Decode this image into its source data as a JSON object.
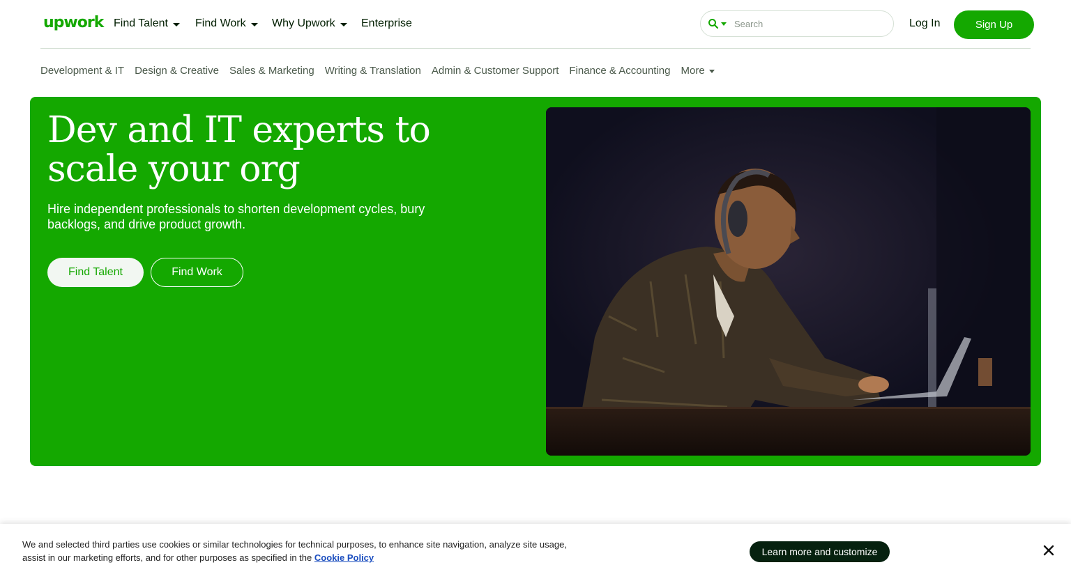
{
  "header": {
    "logo": "upwork",
    "nav": [
      {
        "label": "Find Talent",
        "dropdown": true
      },
      {
        "label": "Find Work",
        "dropdown": true
      },
      {
        "label": "Why Upwork",
        "dropdown": true
      },
      {
        "label": "Enterprise",
        "dropdown": false
      }
    ],
    "search_placeholder": "Search",
    "login_label": "Log In",
    "signup_label": "Sign Up"
  },
  "categories": [
    "Development & IT",
    "Design & Creative",
    "Sales & Marketing",
    "Writing & Translation",
    "Admin & Customer Support",
    "Finance & Accounting"
  ],
  "more_label": "More",
  "hero": {
    "title": "Dev and IT experts to scale your org",
    "subtitle": "Hire independent professionals to shorten development cycles, bury backlogs, and drive product growth.",
    "find_talent_label": "Find Talent",
    "find_work_label": "Find Work"
  },
  "cookie": {
    "text": "We and selected third parties use cookies or similar technologies for technical purposes, to enhance site navigation, analyze site usage, assist in our marketing efforts, and for other purposes as specified in the",
    "link_label": "Cookie Policy",
    "learn_label": "Learn more and customize"
  },
  "colors": {
    "brand_green": "#14a800",
    "dark_button": "#06210f"
  },
  "icons": [
    "search-icon",
    "chevron-down-icon",
    "close-icon"
  ]
}
